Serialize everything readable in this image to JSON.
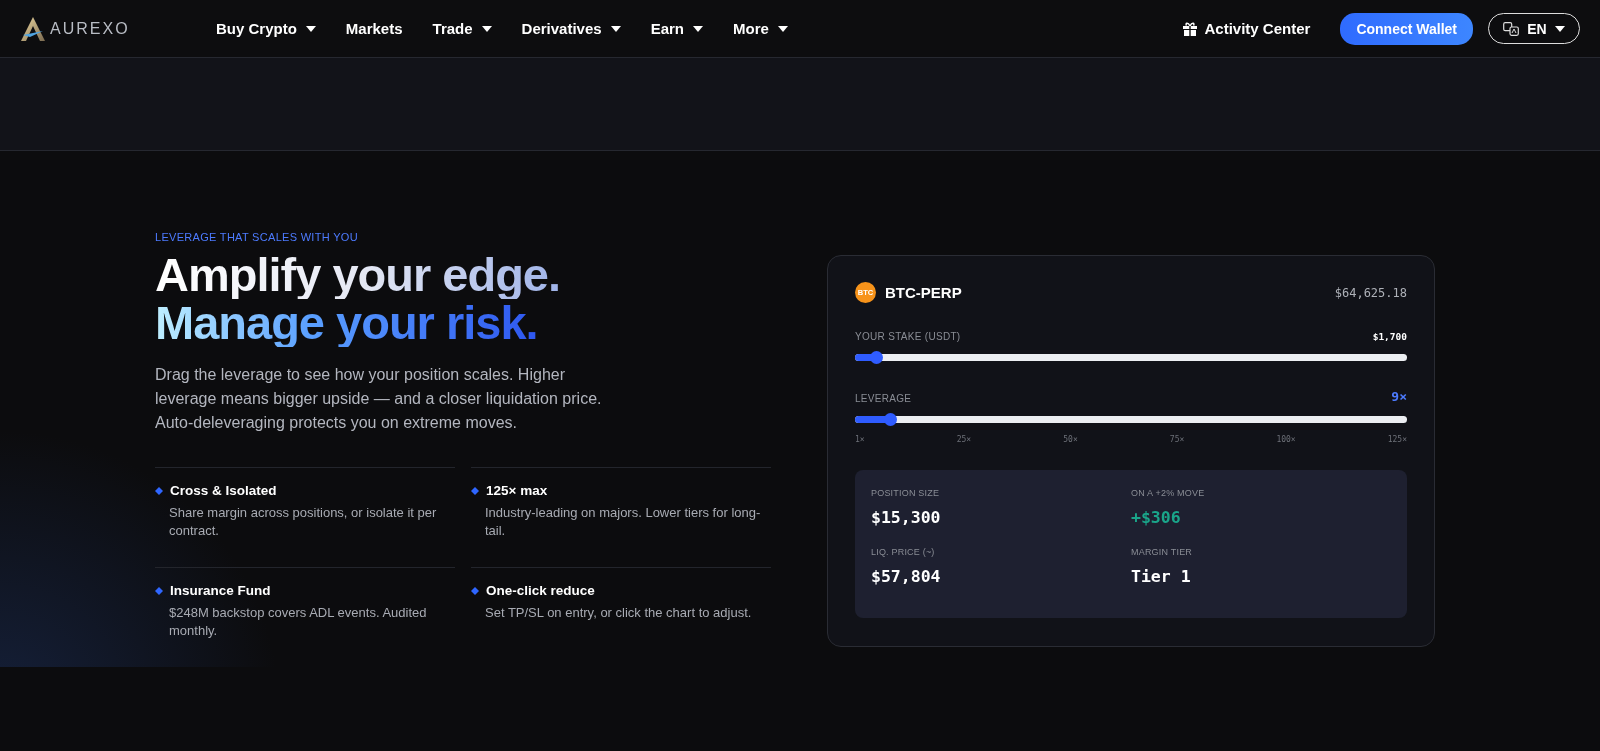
{
  "nav": {
    "logo": "AUREXO",
    "items": [
      {
        "label": "Buy Crypto",
        "caret": true
      },
      {
        "label": "Markets",
        "caret": false
      },
      {
        "label": "Trade",
        "caret": true
      },
      {
        "label": "Derivatives",
        "caret": true
      },
      {
        "label": "Earn",
        "caret": true
      },
      {
        "label": "More",
        "caret": true
      }
    ],
    "activity": "Activity Center",
    "connect": "Connect Wallet",
    "language": "EN"
  },
  "hero": {
    "eyebrow": "LEVERAGE THAT SCALES WITH YOU",
    "headline": [
      "Amplify your edge.",
      "Manage your risk."
    ],
    "description": "Drag the leverage to see how your position scales. Higher leverage means bigger upside — and a closer liquidation price. Auto-deleveraging protects you on extreme moves.",
    "features": [
      {
        "title": "Cross & Isolated",
        "text": "Share margin across positions, or isolate it per contract."
      },
      {
        "title": "125× max",
        "text": "Industry-leading on majors. Lower tiers for long-tail."
      },
      {
        "title": "Insurance Fund",
        "text": "$248M backstop covers ADL events. Audited monthly."
      },
      {
        "title": "One-click reduce",
        "text": "Set TP/SL on entry, or click the chart to adjust."
      }
    ]
  },
  "calculator": {
    "coin_badge": "BTC",
    "pair": "BTC-PERP",
    "price": "$64,625.18",
    "sliders": [
      {
        "label": "YOUR STAKE (USDT)",
        "reading": "$1,700",
        "accent": false,
        "level": 0.04
      },
      {
        "label": "LEVERAGE",
        "reading": "9×",
        "accent": true,
        "level": 0.065,
        "ticks": [
          "1×",
          "25×",
          "50×",
          "75×",
          "100×",
          "125×"
        ]
      }
    ],
    "metrics": [
      {
        "label": "POSITION SIZE",
        "value": "$15,300",
        "kind": "plain"
      },
      {
        "label": "ON A +2% MOVE",
        "value": "+$306",
        "kind": "gain"
      },
      {
        "label": "LIQ. PRICE (~)",
        "value": "$57,804",
        "kind": "plain"
      },
      {
        "label": "MARGIN TIER",
        "value": "Tier 1",
        "kind": "plain"
      }
    ]
  }
}
